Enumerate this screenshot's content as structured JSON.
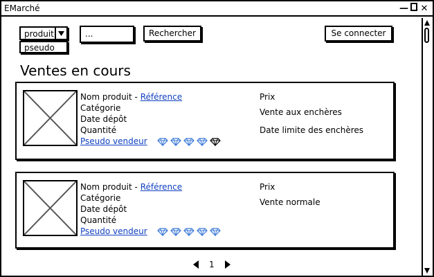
{
  "window": {
    "title": "EMarché"
  },
  "search": {
    "filter_selected": "produit",
    "filter_options": [
      "pseudo"
    ],
    "placeholder": "...",
    "search_button": "Rechercher"
  },
  "header": {
    "connect_button": "Se connecter"
  },
  "page": {
    "title": "Ventes en cours"
  },
  "listings": [
    {
      "product_name": "Nom produit",
      "separator": " - ",
      "reference": "Référence",
      "category": "Catégorie",
      "date_deposit": "Date dépôt",
      "quantity": "Quantité",
      "seller": "Pseudo vendeur",
      "rating_filled": 4,
      "rating_total": 5,
      "price": "Prix",
      "sale_type": "Vente aux enchères",
      "deadline": "Date limite des enchères"
    },
    {
      "product_name": "Nom produit",
      "separator": " - ",
      "reference": "Référence",
      "category": "Catégorie",
      "date_deposit": "Date dépôt",
      "quantity": "Quantité",
      "seller": "Pseudo vendeur",
      "rating_filled": 5,
      "rating_total": 5,
      "price": "Prix",
      "sale_type": "Vente normale"
    }
  ],
  "pagination": {
    "current_page": "1"
  },
  "colors": {
    "link": "#1040c0",
    "gem_blue": "#3a78d8",
    "gem_black": "#000000"
  }
}
